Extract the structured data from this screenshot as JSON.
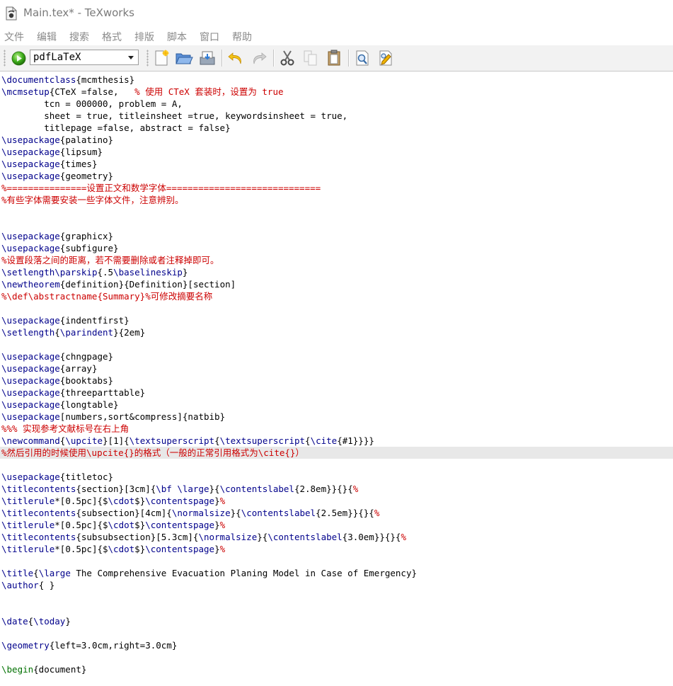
{
  "window": {
    "title": "Main.tex* - TeXworks"
  },
  "menu": {
    "items": [
      "文件",
      "编辑",
      "搜索",
      "格式",
      "排版",
      "脚本",
      "窗口",
      "帮助"
    ]
  },
  "toolbar": {
    "engine": "pdfLaTeX",
    "icons": [
      "typeset-icon",
      "new-file-icon",
      "open-folder-icon",
      "save-icon",
      "undo-icon",
      "redo-icon",
      "cut-icon",
      "copy-icon",
      "paste-icon",
      "find-icon",
      "replace-icon"
    ]
  },
  "editor": {
    "current_line": 31,
    "lines": [
      [
        [
          "cmd",
          "\\documentclass"
        ],
        [
          "txt",
          "{mcmthesis}"
        ]
      ],
      [
        [
          "cmd",
          "\\mcmsetup"
        ],
        [
          "txt",
          "{CTeX =false,   "
        ],
        [
          "cmt",
          "% 使用 CTeX 套装时，设置为 true"
        ]
      ],
      [
        [
          "txt",
          "        tcn = 000000, problem = A,"
        ]
      ],
      [
        [
          "txt",
          "        sheet = true, titleinsheet =true, keywordsinsheet = true,"
        ]
      ],
      [
        [
          "txt",
          "        titlepage =false, abstract = false}"
        ]
      ],
      [
        [
          "cmd",
          "\\usepackage"
        ],
        [
          "txt",
          "{palatino}"
        ]
      ],
      [
        [
          "cmd",
          "\\usepackage"
        ],
        [
          "txt",
          "{lipsum}"
        ]
      ],
      [
        [
          "cmd",
          "\\usepackage"
        ],
        [
          "txt",
          "{times}"
        ]
      ],
      [
        [
          "cmd",
          "\\usepackage"
        ],
        [
          "txt",
          "{geometry}"
        ]
      ],
      [
        [
          "cmt",
          "%===============设置正文和数学字体============================="
        ]
      ],
      [
        [
          "cmt",
          "%有些字体需要安装一些字体文件，注意辨别。"
        ]
      ],
      [],
      [],
      [
        [
          "cmd",
          "\\usepackage"
        ],
        [
          "txt",
          "{graphicx}"
        ]
      ],
      [
        [
          "cmd",
          "\\usepackage"
        ],
        [
          "txt",
          "{subfigure}"
        ]
      ],
      [
        [
          "cmt",
          "%设置段落之间的距离，若不需要删除或者注释掉即可。"
        ]
      ],
      [
        [
          "cmd",
          "\\setlength"
        ],
        [
          "cmd",
          "\\parskip"
        ],
        [
          "txt",
          "{.5"
        ],
        [
          "cmd",
          "\\baselineskip"
        ],
        [
          "txt",
          "}"
        ]
      ],
      [
        [
          "cmd",
          "\\newtheorem"
        ],
        [
          "txt",
          "{definition}{Definition}[section]"
        ]
      ],
      [
        [
          "cmt",
          "%\\def\\abstractname{Summary}%可修改摘要名称"
        ]
      ],
      [],
      [
        [
          "cmd",
          "\\usepackage"
        ],
        [
          "txt",
          "{indentfirst}"
        ]
      ],
      [
        [
          "cmd",
          "\\setlength"
        ],
        [
          "txt",
          "{"
        ],
        [
          "cmd",
          "\\parindent"
        ],
        [
          "txt",
          "}{2em}"
        ]
      ],
      [],
      [
        [
          "cmd",
          "\\usepackage"
        ],
        [
          "txt",
          "{chngpage}"
        ]
      ],
      [
        [
          "cmd",
          "\\usepackage"
        ],
        [
          "txt",
          "{array}"
        ]
      ],
      [
        [
          "cmd",
          "\\usepackage"
        ],
        [
          "txt",
          "{booktabs}"
        ]
      ],
      [
        [
          "cmd",
          "\\usepackage"
        ],
        [
          "txt",
          "{threeparttable}"
        ]
      ],
      [
        [
          "cmd",
          "\\usepackage"
        ],
        [
          "txt",
          "{longtable}"
        ]
      ],
      [
        [
          "cmd",
          "\\usepackage"
        ],
        [
          "txt",
          "[numbers,sort&compress]{natbib}"
        ]
      ],
      [
        [
          "cmt",
          "%%% 实现参考文献标号在右上角"
        ]
      ],
      [
        [
          "cmd",
          "\\newcommand"
        ],
        [
          "txt",
          "{"
        ],
        [
          "cmd",
          "\\upcite"
        ],
        [
          "txt",
          "}[1]{"
        ],
        [
          "cmd",
          "\\textsuperscript"
        ],
        [
          "txt",
          "{"
        ],
        [
          "cmd",
          "\\textsuperscript"
        ],
        [
          "txt",
          "{"
        ],
        [
          "cmd",
          "\\cite"
        ],
        [
          "txt",
          "{#1}}}}"
        ]
      ],
      [
        [
          "cmt",
          "%然后引用的时候使用\\upcite{}的格式（一般的正常引用格式为\\cite{}）"
        ]
      ],
      [],
      [
        [
          "cmd",
          "\\usepackage"
        ],
        [
          "txt",
          "{titletoc}"
        ]
      ],
      [
        [
          "cmd",
          "\\titlecontents"
        ],
        [
          "txt",
          "{section}[3cm]{"
        ],
        [
          "cmd",
          "\\bf"
        ],
        [
          "txt",
          " "
        ],
        [
          "cmd",
          "\\large"
        ],
        [
          "txt",
          "}{"
        ],
        [
          "cmd",
          "\\contentslabel"
        ],
        [
          "txt",
          "{2.8em}}{}{"
        ],
        [
          "cmt",
          "%"
        ]
      ],
      [
        [
          "cmd",
          "\\titlerule"
        ],
        [
          "txt",
          "*[0.5pc]{$"
        ],
        [
          "cmd",
          "\\cdot"
        ],
        [
          "txt",
          "$}"
        ],
        [
          "cmd",
          "\\contentspage"
        ],
        [
          "txt",
          "}"
        ],
        [
          "cmt",
          "%"
        ]
      ],
      [
        [
          "cmd",
          "\\titlecontents"
        ],
        [
          "txt",
          "{subsection}[4cm]{"
        ],
        [
          "cmd",
          "\\normalsize"
        ],
        [
          "txt",
          "}{"
        ],
        [
          "cmd",
          "\\contentslabel"
        ],
        [
          "txt",
          "{2.5em}}{}{"
        ],
        [
          "cmt",
          "%"
        ]
      ],
      [
        [
          "cmd",
          "\\titlerule"
        ],
        [
          "txt",
          "*[0.5pc]{$"
        ],
        [
          "cmd",
          "\\cdot"
        ],
        [
          "txt",
          "$}"
        ],
        [
          "cmd",
          "\\contentspage"
        ],
        [
          "txt",
          "}"
        ],
        [
          "cmt",
          "%"
        ]
      ],
      [
        [
          "cmd",
          "\\titlecontents"
        ],
        [
          "txt",
          "{subsubsection}[5.3cm]{"
        ],
        [
          "cmd",
          "\\normalsize"
        ],
        [
          "txt",
          "}{"
        ],
        [
          "cmd",
          "\\contentslabel"
        ],
        [
          "txt",
          "{3.0em}}{}{"
        ],
        [
          "cmt",
          "%"
        ]
      ],
      [
        [
          "cmd",
          "\\titlerule"
        ],
        [
          "txt",
          "*[0.5pc]{$"
        ],
        [
          "cmd",
          "\\cdot"
        ],
        [
          "txt",
          "$}"
        ],
        [
          "cmd",
          "\\contentspage"
        ],
        [
          "txt",
          "}"
        ],
        [
          "cmt",
          "%"
        ]
      ],
      [],
      [
        [
          "cmd",
          "\\title"
        ],
        [
          "txt",
          "{"
        ],
        [
          "cmd",
          "\\large"
        ],
        [
          "txt",
          " The Comprehensive Evacuation Planing Model in Case of Emergency}"
        ]
      ],
      [
        [
          "cmd",
          "\\author"
        ],
        [
          "txt",
          "{ }"
        ]
      ],
      [],
      [],
      [
        [
          "cmd",
          "\\date"
        ],
        [
          "txt",
          "{"
        ],
        [
          "cmd",
          "\\today"
        ],
        [
          "txt",
          "}"
        ]
      ],
      [],
      [
        [
          "cmd",
          "\\geometry"
        ],
        [
          "txt",
          "{left=3.0cm,right=3.0cm}"
        ]
      ],
      [],
      [
        [
          "grn",
          "\\begin"
        ],
        [
          "txt",
          "{document}"
        ]
      ]
    ]
  }
}
